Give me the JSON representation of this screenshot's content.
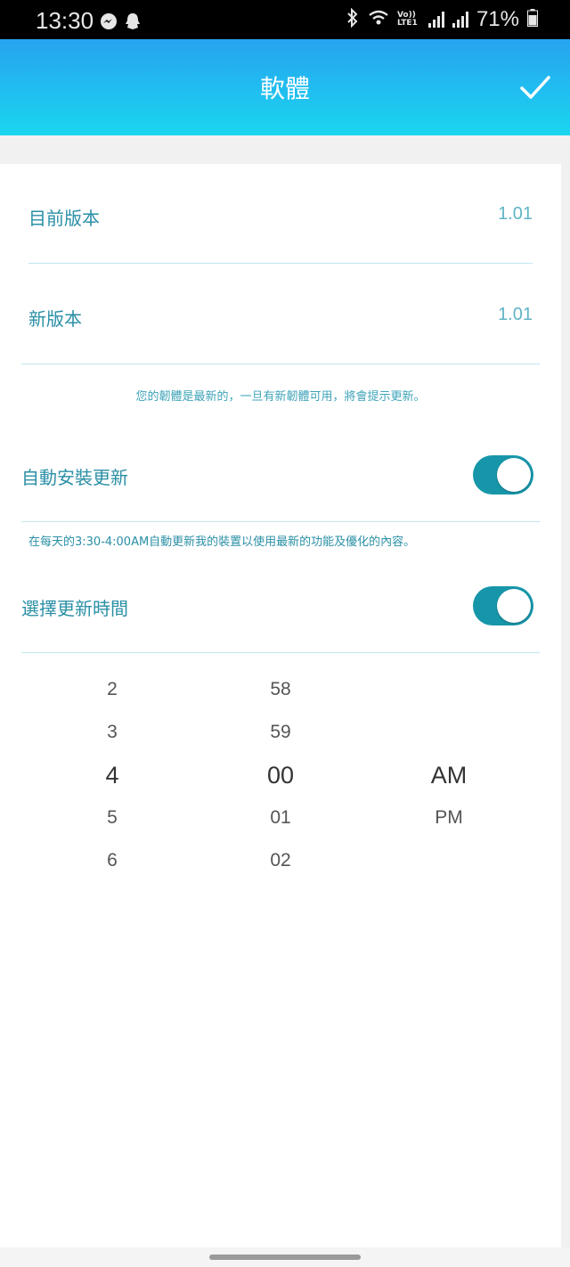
{
  "status_bar": {
    "time": "13:30",
    "icons_left": [
      "messenger-icon",
      "ghost-icon"
    ],
    "icons_right": [
      "bluetooth-icon",
      "wifi-icon",
      "volte-icon",
      "signal-icon",
      "signal-roaming-icon",
      "battery-icon"
    ],
    "volte_label": "Vo)) LTE1",
    "battery": "71%"
  },
  "appbar": {
    "title": "軟體",
    "confirm_icon": "check-icon"
  },
  "firmware": {
    "current_label": "目前版本",
    "current_value": "1.01",
    "new_label": "新版本",
    "new_value": "1.01",
    "notice": "您的韌體是最新的，一旦有新韌體可用，將會提示更新。"
  },
  "auto_update": {
    "label": "自動安裝更新",
    "enabled": true,
    "description": "在每天的3:30-4:00AM自動更新我的裝置以使用最新的功能及優化的內容。"
  },
  "schedule": {
    "label": "選擇更新時間",
    "enabled": true
  },
  "time_picker": {
    "hours": [
      "2",
      "3",
      "4",
      "5",
      "6"
    ],
    "minutes": [
      "58",
      "59",
      "00",
      "01",
      "02"
    ],
    "period": [
      "AM",
      "PM"
    ],
    "selected": {
      "hour": "4",
      "minute": "00",
      "period": "AM"
    }
  },
  "colors": {
    "accent": "#1796aa",
    "header_gradient_top": "#27a3f0",
    "header_gradient_bottom": "#1ad6ef",
    "label_text": "#2a8fa6"
  }
}
